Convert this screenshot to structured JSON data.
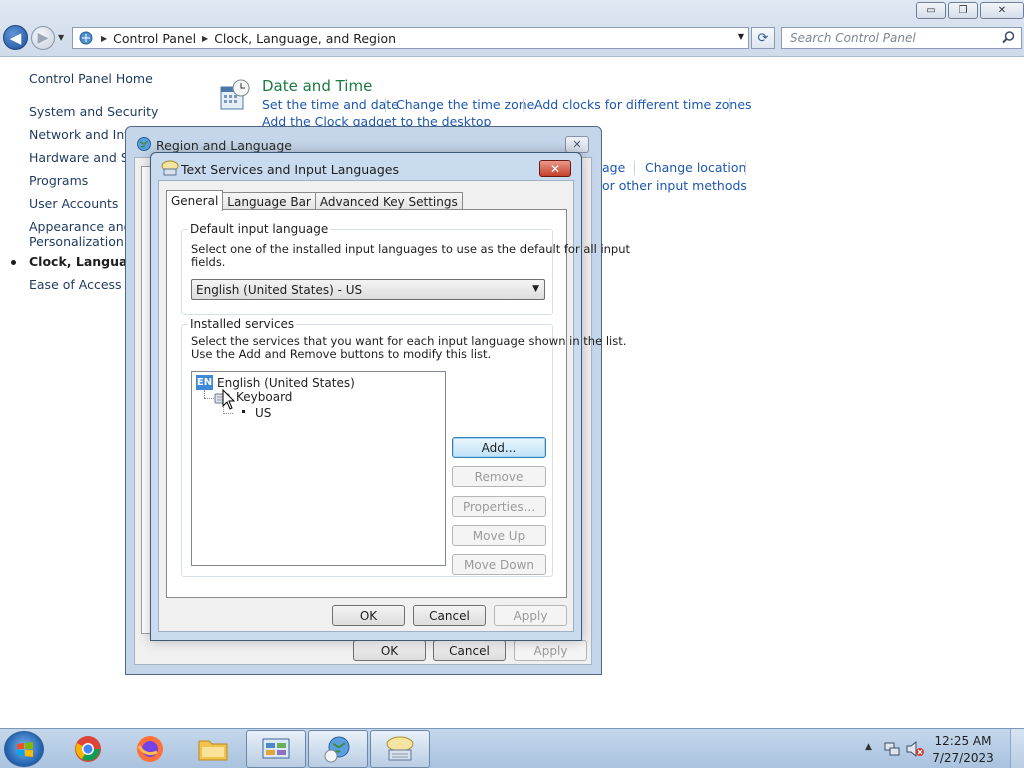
{
  "window": {
    "address": {
      "crumbs": [
        "Control Panel",
        "Clock, Language, and Region"
      ]
    },
    "search": {
      "placeholder": "Search Control Panel"
    },
    "caption": {
      "minimize": "▭",
      "maximize": "❐",
      "close": "✕"
    }
  },
  "leftnav": {
    "home": "Control Panel Home",
    "items": [
      "System and Security",
      "Network and Inter",
      "Hardware and Sou",
      "Programs",
      "User Accounts",
      "Appearance and",
      "Personalization",
      "Clock, Language, a",
      "Ease of Access"
    ]
  },
  "main": {
    "date_time": {
      "title": "Date and Time",
      "links": [
        "Set the time and date",
        "Change the time zone",
        "Add clocks for different time zones",
        "Add the Clock gadget to the desktop"
      ]
    },
    "region_links": [
      "age",
      "Change location",
      "or other input methods"
    ]
  },
  "region_dialog": {
    "title": "Region and Language",
    "close": "✕",
    "buttons": {
      "ok": "OK",
      "cancel": "Cancel",
      "apply": "Apply"
    }
  },
  "text_services_dialog": {
    "title": "Text Services and Input Languages",
    "close": "✕",
    "tabs": [
      "General",
      "Language Bar",
      "Advanced Key Settings"
    ],
    "default_input": {
      "legend": "Default input language",
      "description_line1": "Select one of the installed input languages to use as the default for all input",
      "description_line2": "fields.",
      "selected": "English (United States) - US"
    },
    "installed": {
      "legend": "Installed services",
      "description_line1": "Select the services that you want for each input language shown in the list.",
      "description_line2": "Use the Add and Remove buttons to modify this list.",
      "tree": {
        "badge": "EN",
        "language": "English (United States)",
        "category": "Keyboard",
        "layout": "US"
      },
      "side_buttons": {
        "add": "Add...",
        "remove": "Remove",
        "properties": "Properties...",
        "move_up": "Move Up",
        "move_down": "Move Down"
      }
    },
    "buttons": {
      "ok": "OK",
      "cancel": "Cancel",
      "apply": "Apply"
    }
  },
  "taskbar": {
    "time": "12:25 AM",
    "date": "7/27/2023"
  }
}
